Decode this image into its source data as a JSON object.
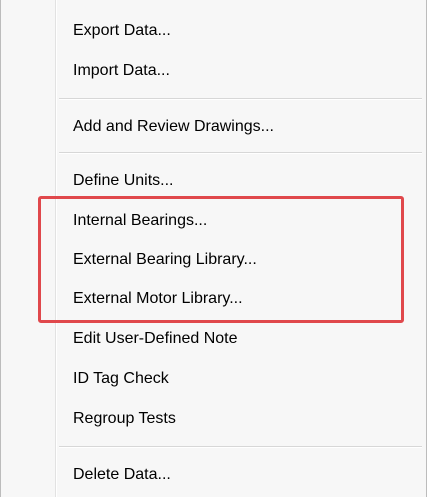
{
  "menu": {
    "items": [
      {
        "label": "Export Data..."
      },
      {
        "label": "Import Data..."
      },
      {
        "label": "Add and Review Drawings..."
      },
      {
        "label": "Define Units..."
      },
      {
        "label": "Internal Bearings..."
      },
      {
        "label": "External Bearing Library..."
      },
      {
        "label": "External Motor Library..."
      },
      {
        "label": "Edit User-Defined Note"
      },
      {
        "label": "ID Tag Check"
      },
      {
        "label": "Regroup Tests"
      },
      {
        "label": "Delete Data..."
      }
    ]
  },
  "highlight": {
    "color": "#e0484c"
  }
}
